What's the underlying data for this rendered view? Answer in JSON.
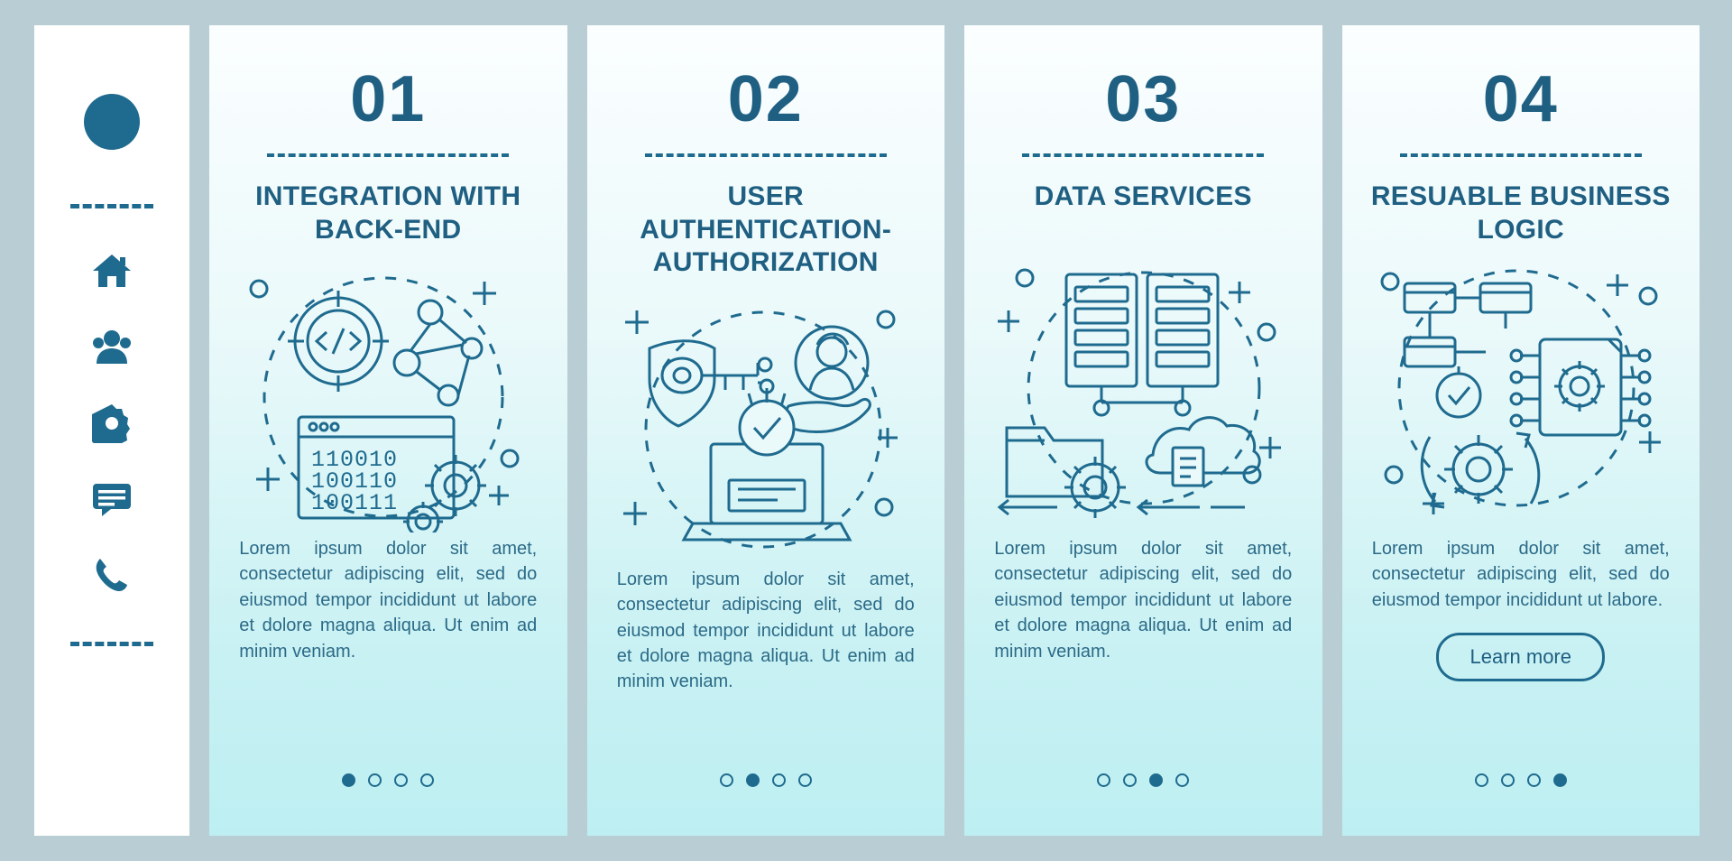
{
  "sidebar": {
    "logo": "logo-circle",
    "icons": [
      {
        "name": "home-icon"
      },
      {
        "name": "people-icon"
      },
      {
        "name": "gear-icon"
      },
      {
        "name": "chat-icon"
      },
      {
        "name": "phone-icon"
      }
    ]
  },
  "colors": {
    "primary": "#1f6b8f",
    "title": "#1f5f82",
    "body": "#2b6a87",
    "background": "#b9cdd4",
    "card_top": "#fbfeff",
    "card_bottom": "#bdeff2",
    "sidebar": "#ffffff"
  },
  "cards": [
    {
      "number": "01",
      "title": "INTEGRATION WITH BACK-END",
      "body": "Lorem ipsum dolor sit amet, consectetur adipiscing elit, sed do eiusmod tempor incididunt ut labore et dolore magna aliqua. Ut enim ad minim veniam.",
      "illustration": "code-network-binary-gear-illustration",
      "dots": 4,
      "active_dot": 0,
      "button": null
    },
    {
      "number": "02",
      "title": "USER AUTHENTICATION-AUTHORIZATION",
      "body": "Lorem ipsum dolor sit amet, consectetur adipiscing elit, sed do eiusmod tempor incididunt ut labore et dolore magna aliqua. Ut enim ad minim veniam.",
      "illustration": "key-shield-user-laptop-illustration",
      "dots": 4,
      "active_dot": 1,
      "button": null
    },
    {
      "number": "03",
      "title": "DATA SERVICES",
      "body": "Lorem ipsum dolor sit amet, consectetur adipiscing elit, sed do eiusmod tempor incididunt ut labore et dolore magna aliqua. Ut enim ad minim veniam.",
      "illustration": "servers-folder-cloud-illustration",
      "dots": 4,
      "active_dot": 2,
      "button": null
    },
    {
      "number": "04",
      "title": "RESUABLE BUSINESS LOGIC",
      "body": "Lorem ipsum dolor sit amet, consectetur adipiscing elit, sed do eiusmod tempor incididunt ut labore.",
      "illustration": "flowchart-chip-refresh-illustration",
      "dots": 4,
      "active_dot": 3,
      "button": "Learn more"
    }
  ]
}
